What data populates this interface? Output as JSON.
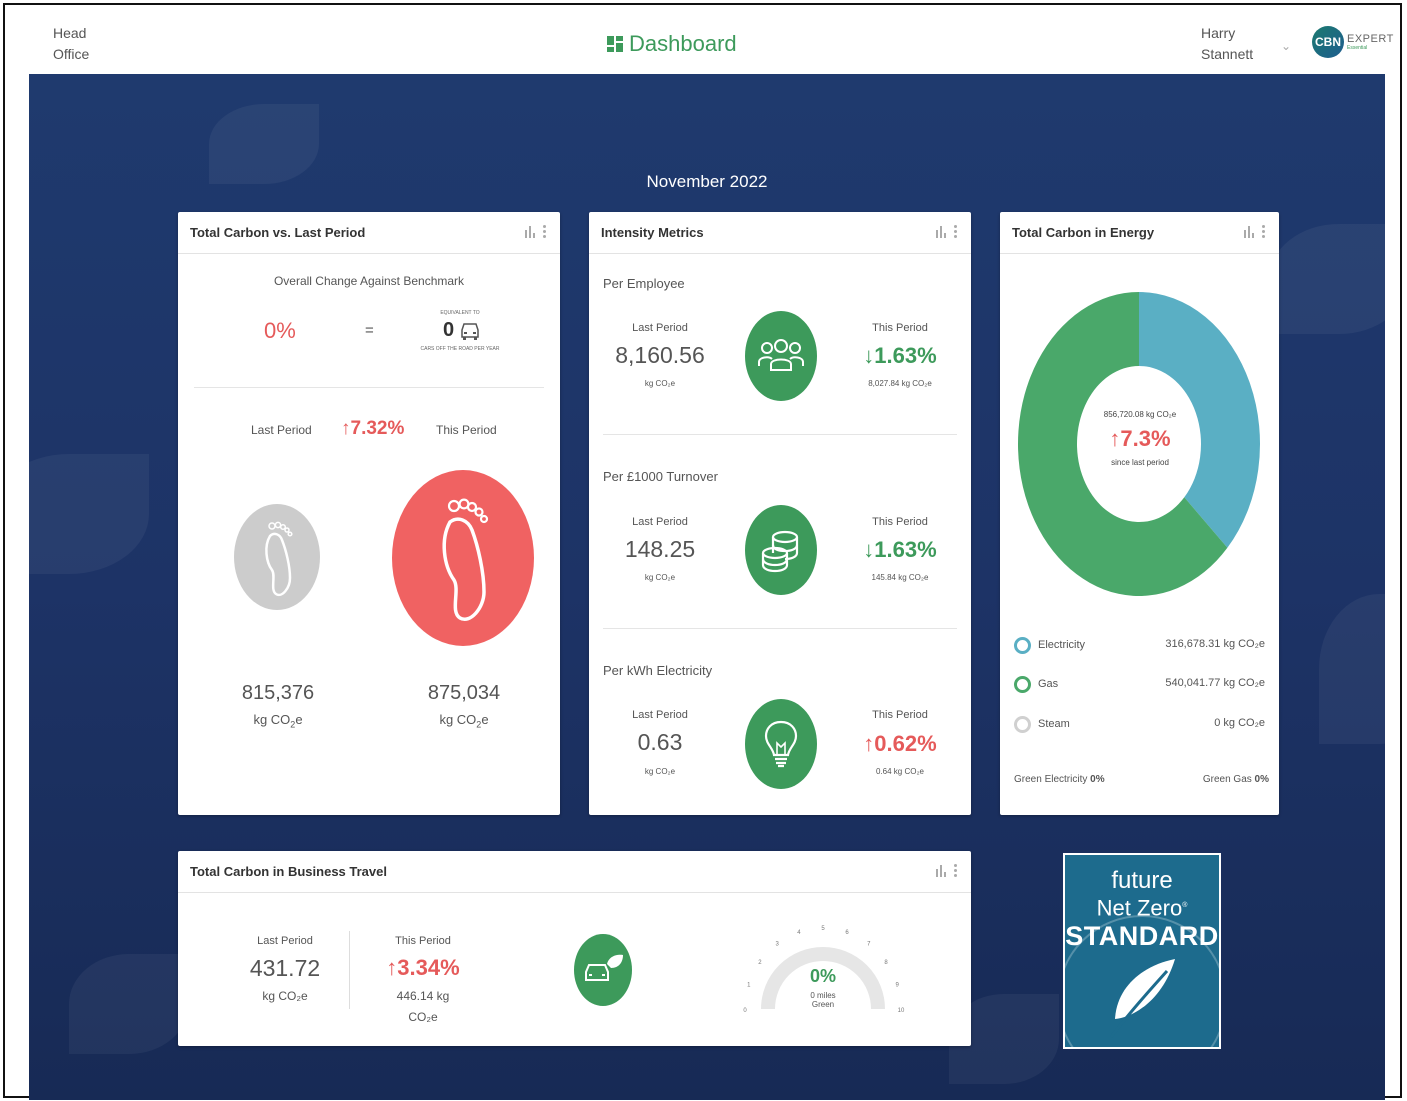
{
  "header": {
    "location": "Head Office",
    "title": "Dashboard",
    "user": "Harry Stannett",
    "logo_short": "CBN",
    "logo_text": "EXPERT",
    "logo_sub": "Essential"
  },
  "period": "November 2022",
  "total_carbon": {
    "title": "Total Carbon vs. Last Period",
    "benchmark_label": "Overall Change Against Benchmark",
    "benchmark_change": "0%",
    "equals": "=",
    "equivalent_label": "EQUIVALENT TO",
    "cars_value": "0",
    "cars_label": "CARS OFF THE ROAD PER YEAR",
    "last_label": "Last Period",
    "change": "7.32%",
    "this_label": "This Period",
    "last_value": "815,376",
    "this_value": "875,034",
    "unit_pre": "kg CO",
    "unit_sub": "2",
    "unit_post": "e"
  },
  "intensity": {
    "title": "Intensity Metrics",
    "rows": [
      {
        "label": "Per Employee",
        "last_label": "Last Period",
        "last_value": "8,160.56",
        "unit": "kg CO₂e",
        "this_label": "This Period",
        "change": "1.63%",
        "direction": "down",
        "this_value": "8,027.84 kg CO₂e",
        "icon": "people-icon"
      },
      {
        "label": "Per £1000 Turnover",
        "last_label": "Last Period",
        "last_value": "148.25",
        "unit": "kg CO₂e",
        "this_label": "This Period",
        "change": "1.63%",
        "direction": "down",
        "this_value": "145.84 kg CO₂e",
        "icon": "coins-icon"
      },
      {
        "label": "Per kWh Electricity",
        "last_label": "Last Period",
        "last_value": "0.63",
        "unit": "kg CO₂e",
        "this_label": "This Period",
        "change": "0.62%",
        "direction": "up",
        "this_value": "0.64 kg CO₂e",
        "icon": "lightbulb-icon"
      }
    ]
  },
  "energy": {
    "title": "Total Carbon in Energy",
    "center_value": "856,720.08 kg CO₂e",
    "center_change": "7.3%",
    "center_caption": "since last period",
    "items": [
      {
        "label": "Electricity",
        "value": "316,678.31 kg CO₂e",
        "color": "#5aafc4"
      },
      {
        "label": "Gas",
        "value": "540,041.77 kg CO₂e",
        "color": "#4aa86a"
      },
      {
        "label": "Steam",
        "value": "0 kg CO₂e",
        "color": "#d0d0d0"
      }
    ],
    "green_electricity_label": "Green Electricity",
    "green_electricity_value": "0%",
    "green_gas_label": "Green Gas",
    "green_gas_value": "0%"
  },
  "travel": {
    "title": "Total Carbon in Business Travel",
    "last_label": "Last Period",
    "last_value": "431.72",
    "last_unit": "kg CO₂e",
    "this_label": "This Period",
    "change": "3.34%",
    "this_value": "446.14 kg",
    "this_unit": "CO₂e",
    "gauge_value": "0%",
    "gauge_miles": "0 miles",
    "gauge_caption": "Green",
    "gauge_ticks": [
      "0",
      "1",
      "2",
      "3",
      "4",
      "5",
      "6",
      "7",
      "8",
      "9",
      "10"
    ]
  },
  "badge": {
    "line1": "future",
    "line2": "Net Zero",
    "reg": "®",
    "line3": "STANDARD"
  },
  "colors": {
    "green": "#3d9a5b",
    "red": "#e55a5a",
    "electricity": "#5aafc4",
    "gas": "#4aa86a",
    "background": "#1f3a6e"
  }
}
